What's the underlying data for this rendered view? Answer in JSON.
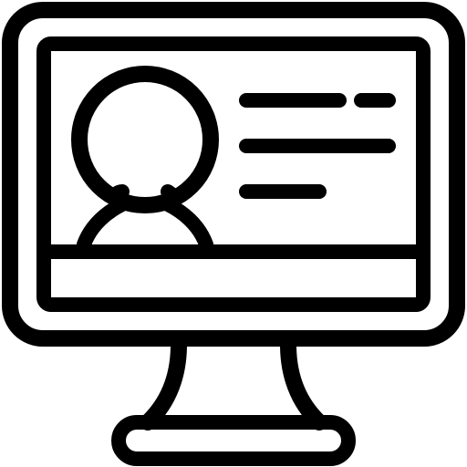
{
  "icon": {
    "name": "computer-user-profile-icon",
    "parts": {
      "monitor": "monitor-icon",
      "avatar": "user-avatar-icon",
      "text_lines": "text-lines-icon",
      "stand": "monitor-stand-icon"
    },
    "colors": {
      "stroke": "#000000",
      "background": "#ffffff"
    }
  }
}
